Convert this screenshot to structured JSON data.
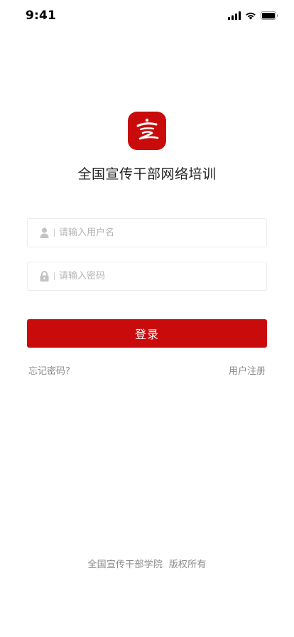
{
  "status_bar": {
    "time": "9:41",
    "icons": [
      "cellular-signal-icon",
      "wifi-icon",
      "battery-icon"
    ]
  },
  "brand": {
    "logo_icon": "xuan-logo-icon",
    "logo_color": "#c90b0b",
    "title": "全国宣传干部网络培训"
  },
  "login_form": {
    "username": {
      "icon": "user-icon",
      "placeholder": "请输入用户名",
      "value": ""
    },
    "password": {
      "icon": "lock-icon",
      "placeholder": "请输入密码",
      "value": ""
    },
    "submit_label": "登录",
    "forgot_label": "忘记密码?",
    "register_label": "用户注册"
  },
  "footer": {
    "copyright": "全国宣传干部学院  版权所有"
  },
  "colors": {
    "accent": "#c90b0b",
    "muted_text": "#8a8a8a",
    "placeholder": "#b4b4b4",
    "border": "#ececec"
  }
}
